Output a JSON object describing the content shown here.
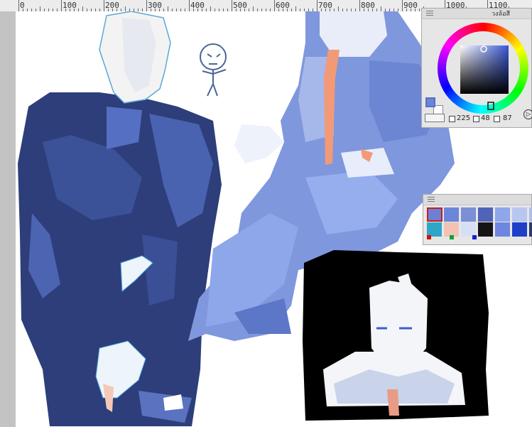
{
  "ruler": {
    "labels": [
      "0",
      "100",
      "200",
      "300",
      "400",
      "500",
      "600",
      "700",
      "800",
      "900",
      "1000",
      "1100"
    ]
  },
  "color_panel": {
    "title": "วงล้อสี",
    "hue_ring_indicator": "ring-marker",
    "stats": {
      "h": "225",
      "s": "48",
      "v": "87"
    },
    "main_color": "#6b86d9",
    "sub_color": "#ffffff",
    "sv_square_top_color": "#3a57d6"
  },
  "palette_panel": {
    "row1": [
      "#6f7fd6",
      "#6b86d9",
      "#7a8fd6",
      "#4f63b7",
      "#8ea6ea",
      "#b8c6f0",
      "#aebde8"
    ],
    "row2": [
      "#2fa6c7",
      "#f2c3b4",
      "#d7dff5",
      "#141414",
      "#6f86e0",
      "#1f3fc8",
      "#2c3a6e"
    ],
    "markers": [
      "#d01010",
      "#10a030",
      "#1020d0"
    ]
  },
  "colors": {
    "canvas": "#ffffff",
    "workspace": "#c8c8c8",
    "suit_dark": "#2d3e7a",
    "suit_light": "#7f97dd",
    "tie": "#f29a76",
    "portrait_bg": "#000000"
  }
}
